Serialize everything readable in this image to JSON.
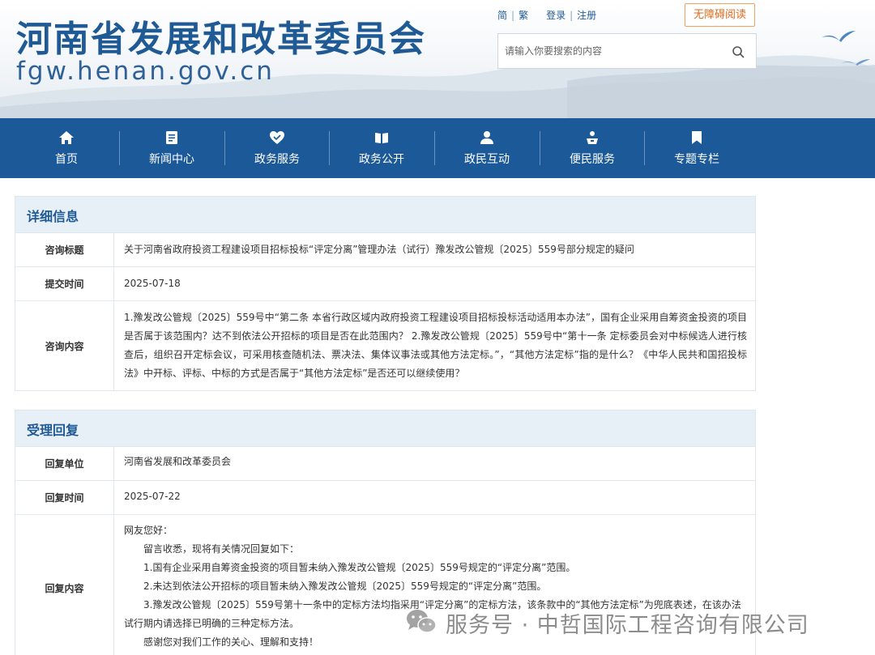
{
  "header": {
    "site_title": "河南省发展和改革委员会",
    "site_domain": "fgw.henan.gov.cn",
    "lang_simplified": "简",
    "lang_traditional": "繁",
    "login": "登录",
    "register": "注册",
    "accessibility": "无障碍阅读",
    "search_placeholder": "请输入你要搜索的内容"
  },
  "nav": {
    "items": [
      {
        "label": "首页",
        "icon": "home-icon"
      },
      {
        "label": "新闻中心",
        "icon": "news-icon"
      },
      {
        "label": "政务服务",
        "icon": "heart-hands-icon"
      },
      {
        "label": "政务公开",
        "icon": "open-book-icon"
      },
      {
        "label": "政民互动",
        "icon": "people-icon"
      },
      {
        "label": "便民服务",
        "icon": "service-icon"
      },
      {
        "label": "专题专栏",
        "icon": "bookmark-icon"
      }
    ]
  },
  "detail": {
    "title": "详细信息",
    "rows": [
      {
        "label": "咨询标题",
        "value": "关于河南省政府投资工程建设项目招标投标“评定分离”管理办法（试行）豫发改公管规〔2025〕559号部分规定的疑问"
      },
      {
        "label": "提交时间",
        "value": "2025-07-18"
      },
      {
        "label": "咨询内容",
        "value": "1.豫发改公管规〔2025〕559号中“第二条 本省行政区域内政府投资工程建设项目招标投标活动适用本办法”，国有企业采用自筹资金投资的项目是否属于该范围内？达不到依法公开招标的项目是否在此范围内？ 2.豫发改公管规〔2025〕559号中“第十一条 定标委员会对中标候选人进行核查后，组织召开定标会议，可采用核查随机法、票决法、集体议事法或其他方法定标。”，“其他方法定标”指的是什么？《中华人民共和国招投标法》中开标、评标、中标的方式是否属于“其他方法定标”是否还可以继续使用？"
      }
    ]
  },
  "reply": {
    "title": "受理回复",
    "rows": [
      {
        "label": "回复单位",
        "value": "河南省发展和改革委员会"
      },
      {
        "label": "回复时间",
        "value": "2025-07-22"
      }
    ],
    "content_label": "回复内容",
    "lines": [
      "网友您好：",
      "留言收悉，现将有关情况回复如下：",
      "1.国有企业采用自筹资金投资的项目暂未纳入豫发改公管规〔2025〕559号规定的“评定分离”范围。",
      "2.未达到依法公开招标的项目暂未纳入豫发改公管规〔2025〕559号规定的“评定分离”范围。",
      "3.豫发改公管规〔2025〕559号第十一条中的定标方法均指采用“评定分离”的定标方法，该条款中的“其他方法定标”为兜底表述，在该办法",
      "试行期内请选择已明确的三种定标方法。",
      "感谢您对我们工作的关心、理解和支持！"
    ]
  },
  "watermark": {
    "text": "服务号 · 中哲国际工程咨询有限公司"
  }
}
